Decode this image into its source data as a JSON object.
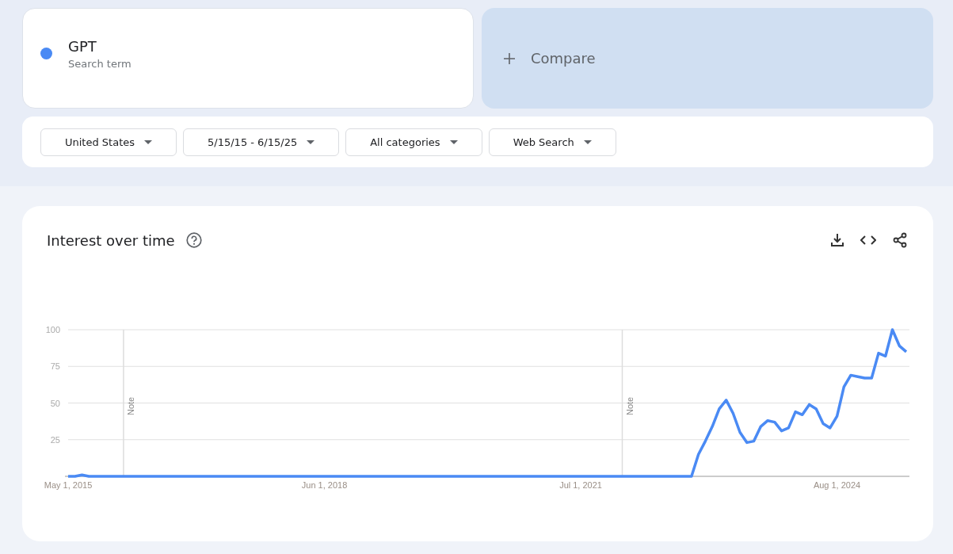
{
  "search_term": {
    "name": "GPT",
    "subtitle": "Search term",
    "color": "#4a8af4"
  },
  "compare": {
    "label": "Compare"
  },
  "filters": [
    "United States",
    "5/15/15 - 6/15/25",
    "All categories",
    "Web Search"
  ],
  "interest_over_time": {
    "title": "Interest over time",
    "chart_data": {
      "type": "line",
      "grid": true,
      "ylim": [
        0,
        100
      ],
      "yticks": [
        25,
        50,
        75,
        100
      ],
      "annotations": [
        "Note",
        "Note"
      ],
      "categories": [
        "May 1, 2015",
        null,
        null,
        null,
        null,
        null,
        null,
        null,
        null,
        null,
        null,
        null,
        null,
        null,
        null,
        null,
        null,
        null,
        null,
        null,
        null,
        null,
        null,
        null,
        null,
        null,
        null,
        null,
        null,
        null,
        null,
        null,
        null,
        null,
        null,
        null,
        null,
        "Jun 1, 2018",
        null,
        null,
        null,
        null,
        null,
        null,
        null,
        null,
        null,
        null,
        null,
        null,
        null,
        null,
        null,
        null,
        null,
        null,
        null,
        null,
        null,
        null,
        null,
        null,
        null,
        null,
        null,
        null,
        null,
        null,
        null,
        null,
        null,
        null,
        null,
        null,
        "Jul 1, 2021",
        null,
        null,
        null,
        null,
        null,
        null,
        null,
        null,
        null,
        null,
        null,
        null,
        null,
        null,
        null,
        null,
        null,
        null,
        null,
        null,
        null,
        null,
        null,
        null,
        null,
        null,
        null,
        null,
        null,
        null,
        null,
        null,
        null,
        null,
        null,
        null,
        "Aug 1, 2024",
        null,
        null,
        null,
        null,
        null,
        null,
        null,
        null,
        null,
        null
      ],
      "series": [
        {
          "color": "#4a8af4",
          "values": [
            0,
            0,
            1,
            0,
            0,
            0,
            0,
            0,
            0,
            0,
            0,
            0,
            0,
            0,
            0,
            0,
            0,
            0,
            0,
            0,
            0,
            0,
            0,
            0,
            0,
            0,
            0,
            0,
            0,
            0,
            0,
            0,
            0,
            0,
            0,
            0,
            0,
            0,
            0,
            0,
            0,
            0,
            0,
            0,
            0,
            0,
            0,
            0,
            0,
            0,
            0,
            0,
            0,
            0,
            0,
            0,
            0,
            0,
            0,
            0,
            0,
            0,
            0,
            0,
            0,
            0,
            0,
            0,
            0,
            0,
            0,
            0,
            0,
            0,
            0,
            0,
            0,
            0,
            0,
            0,
            0,
            0,
            0,
            0,
            0,
            0,
            0,
            0,
            0,
            0,
            0,
            15,
            24,
            34,
            46,
            52,
            43,
            30,
            23,
            24,
            34,
            38,
            37,
            31,
            33,
            44,
            42,
            49,
            46,
            36,
            33,
            41,
            61,
            69,
            68,
            67,
            67,
            84,
            82,
            100,
            89,
            85
          ]
        }
      ]
    }
  }
}
